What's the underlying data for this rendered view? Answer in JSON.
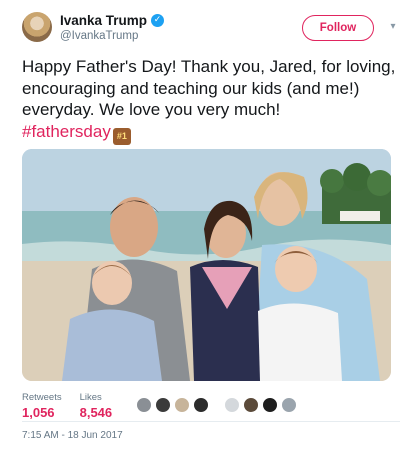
{
  "user": {
    "display_name": "Ivanka Trump",
    "handle": "@IvankaTrump",
    "verified_icon": "verified-badge-icon",
    "avatar_icon": "profile-avatar"
  },
  "header": {
    "follow_label": "Follow",
    "menu_icon": "chevron-down-icon"
  },
  "tweet": {
    "text": "Happy Father's Day! Thank you, Jared, for loving, encouraging and teaching our kids (and me!) everyday. We love you very much!",
    "hashtag": "#fathersday",
    "emoji_label": "#1",
    "photo_description_icon": "family-photo"
  },
  "stats": {
    "retweets_label": "Retweets",
    "retweets_value": "1,056",
    "likes_label": "Likes",
    "likes_value": "8,546"
  },
  "likers": [
    "#8a8f95",
    "#3b3b3b",
    "#c7b49a",
    "#2c2c2c",
    "#d4d8dc",
    "#5b4a3a",
    "#1e1e1e",
    "#9aa4ad"
  ],
  "timestamp": "7:15 AM - 18 Jun 2017",
  "colors": {
    "accent": "#e0245e",
    "verified": "#1da1f2",
    "muted": "#657786"
  }
}
